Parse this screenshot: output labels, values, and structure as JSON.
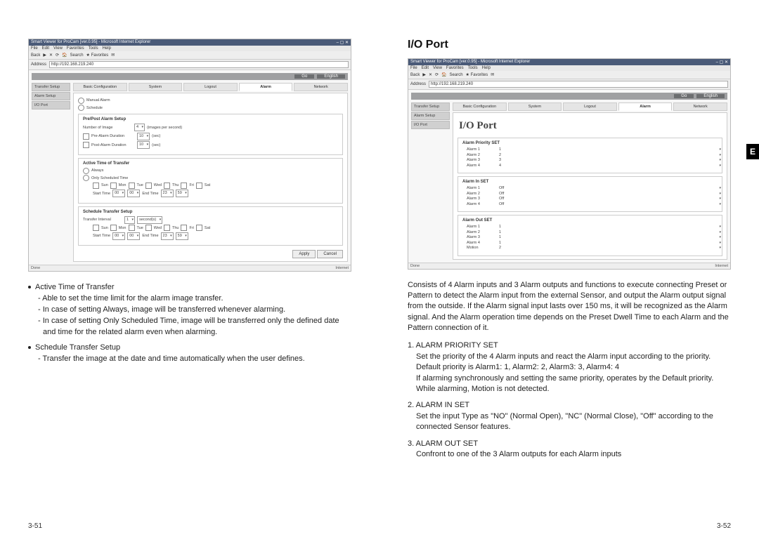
{
  "sidetab": "E",
  "left": {
    "pagenum": "3-51",
    "ie": {
      "title": "Smart Viewer for ProCam [ver.0.95] - Microsoft Internet Explorer",
      "menu": [
        "File",
        "Edit",
        "View",
        "Favorites",
        "Tools",
        "Help"
      ],
      "toolbar": [
        "Back",
        "▶",
        "✕",
        "⟳",
        "🏠",
        "Search",
        "★ Favorites",
        "✉"
      ],
      "address_label": "Address",
      "address": "http://192.168.219.240"
    },
    "topbar": {
      "go": "Go",
      "lang": "English"
    },
    "tabs": [
      "Basic Configuration",
      "System",
      "Logout",
      "Alarm",
      "Network"
    ],
    "active_tab": "Alarm",
    "sidebar": [
      "Transfer Setup",
      "Alarm Setup",
      "I/O Port"
    ],
    "mode_radio": [
      "Manual Alarm",
      "Schedule"
    ],
    "prepost": {
      "legend": "Pre/Post Alarm Setup",
      "num_image_label": "Number of Image",
      "num_image_val": "4",
      "num_image_unit": "(images per second)",
      "pre_label": "Pre-Alarm Duration",
      "pre_val": "10",
      "pre_unit": "(sec)",
      "post_label": "Post-Alarm Duration",
      "post_val": "10",
      "post_unit": "(sec)"
    },
    "active_time": {
      "legend": "Active Time of Transfer",
      "always": "Always",
      "only": "Only Scheduled Time",
      "days": [
        "Sun",
        "Mon",
        "Tue",
        "Wed",
        "Thu",
        "Fri",
        "Sat"
      ],
      "start_label": "Start Time",
      "end_label": "End Time",
      "start_h": "00",
      "start_m": "00",
      "end_h": "23",
      "end_m": "59"
    },
    "schedule": {
      "legend": "Schedule Transfer Setup",
      "interval_label": "Transfer Interval",
      "interval_val": "1",
      "interval_unit": "second(s)",
      "days": [
        "Sun",
        "Mon",
        "Tue",
        "Wed",
        "Thu",
        "Fri",
        "Sat"
      ],
      "start_label": "Start Time",
      "end_label": "End Time",
      "start_h": "00",
      "start_m": "00",
      "end_h": "23",
      "end_m": "59"
    },
    "buttons": {
      "apply": "Apply",
      "cancel": "Cancel"
    },
    "status_left": "Done",
    "status_right": "Internet",
    "text": {
      "b1": "Active Time of Transfer",
      "b1s1": "- Able to set the time limit for the alarm image transfer.",
      "b1s2": "- In case of setting Always, image will be transferred whenever alarming.",
      "b1s3": "- In case of setting Only Scheduled Time, image will be transferred only the defined date and time for the related alarm even when alarming.",
      "b2": "Schedule Transfer Setup",
      "b2s1": "- Transfer the image at the date and time automatically when the user defines."
    }
  },
  "right": {
    "pagenum": "3-52",
    "heading": "I/O Port",
    "ie": {
      "title": "Smart Viewer for ProCam [ver.0.95] - Microsoft Internet Explorer",
      "menu": [
        "File",
        "Edit",
        "View",
        "Favorites",
        "Tools",
        "Help"
      ],
      "toolbar": [
        "Back",
        "▶",
        "✕",
        "⟳",
        "🏠",
        "Search",
        "★ Favorites",
        "✉"
      ],
      "address_label": "Address",
      "address": "http://192.168.219.240"
    },
    "topbar": {
      "go": "Go",
      "lang": "English"
    },
    "tabs": [
      "Basic Configuration",
      "System",
      "Logout",
      "Alarm",
      "Network"
    ],
    "active_tab": "Alarm",
    "sidebar": [
      "Transfer Setup",
      "Alarm Setup",
      "I/O Port"
    ],
    "io_title": "I/O Port",
    "priority_fs": {
      "legend": "Alarm Priority SET",
      "rows": [
        {
          "label": "Alarm 1",
          "val": "1"
        },
        {
          "label": "Alarm 2",
          "val": "2"
        },
        {
          "label": "Alarm 3",
          "val": "3"
        },
        {
          "label": "Alarm 4",
          "val": "4"
        }
      ]
    },
    "in_fs": {
      "legend": "Alarm In SET",
      "rows": [
        {
          "label": "Alarm 1",
          "val": "Off"
        },
        {
          "label": "Alarm 2",
          "val": "Off"
        },
        {
          "label": "Alarm 3",
          "val": "Off"
        },
        {
          "label": "Alarm 4",
          "val": "Off"
        }
      ]
    },
    "out_fs": {
      "legend": "Alarm Out SET",
      "rows": [
        {
          "label": "Alarm 1",
          "val": "1"
        },
        {
          "label": "Alarm 2",
          "val": "1"
        },
        {
          "label": "Alarm 3",
          "val": "1"
        },
        {
          "label": "Alarm 4",
          "val": "1"
        },
        {
          "label": "Motion",
          "val": "2"
        }
      ]
    },
    "status_left": "Done",
    "status_right": "Internet",
    "text": {
      "intro": "Consists of 4 Alarm inputs and 3 Alarm outputs and functions to execute connecting Preset or Pattern to detect the Alarm input from the external Sensor, and output the Alarm output signal from the outside. If the Alarm signal input lasts over 150 ms, it will be recognized as the Alarm signal. And the Alarm operation time depends on the Preset Dwell Time to each Alarm and the Pattern connection of it.",
      "n1_title": "1. ALARM PRIORITY SET",
      "n1_s1": "Set the priority of the 4 Alarm inputs and react the Alarm input according to the priority.",
      "n1_s2": "Default priority is Alarm1: 1, Alarm2: 2, Alarm3: 3, Alarm4: 4",
      "n1_s3": "If alarming synchronously and setting the same priority, operates by the Default priority. While alarming, Motion is not detected.",
      "n2_title": "2. ALARM IN SET",
      "n2_s1": "Set the input Type as \"NO\" (Normal Open), \"NC\" (Normal Close), \"Off\" according to the connected Sensor features.",
      "n3_title": "3. ALARM OUT SET",
      "n3_s1": "Confront to one of the 3 Alarm outputs for each Alarm inputs"
    }
  }
}
